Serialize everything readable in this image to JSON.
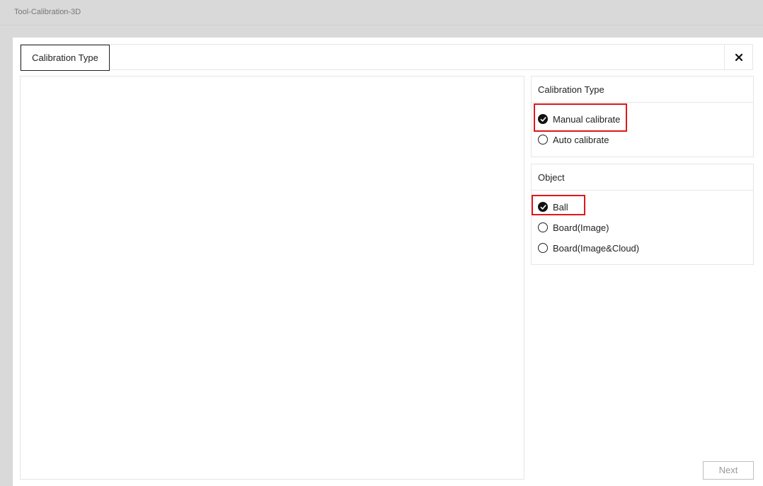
{
  "window": {
    "title": "Tool-Calibration-3D"
  },
  "dialog": {
    "tab_label": "Calibration Type",
    "close_icon": "close-icon"
  },
  "calibration_type": {
    "header": "Calibration Type",
    "options": [
      {
        "label": "Manual calibrate",
        "checked": true
      },
      {
        "label": "Auto calibrate",
        "checked": false
      }
    ]
  },
  "object": {
    "header": "Object",
    "options": [
      {
        "label": "Ball",
        "checked": true
      },
      {
        "label": "Board(Image)",
        "checked": false
      },
      {
        "label": "Board(Image&Cloud)",
        "checked": false
      }
    ]
  },
  "footer": {
    "next_label": "Next"
  },
  "colors": {
    "highlight": "#e0161b",
    "background": "#d9d9d9",
    "dialog": "#ffffff"
  }
}
